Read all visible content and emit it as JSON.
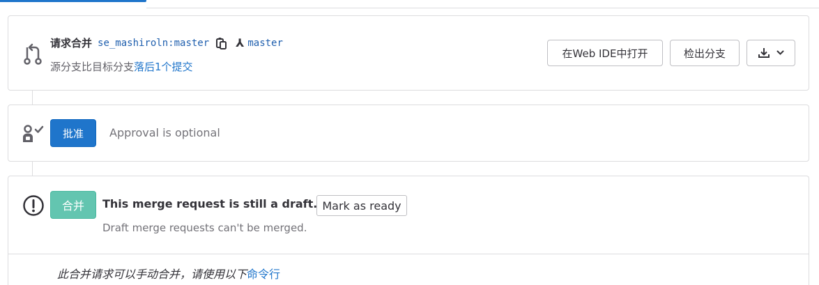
{
  "merge_request": {
    "label": "请求合并",
    "source_branch": "se_mashiroln:master",
    "target_branch": "master",
    "sub_text": "源分支比目标分支",
    "behind_link": "落后1个提交",
    "buttons": {
      "web_ide": "在Web IDE中打开",
      "checkout": "检出分支"
    },
    "icons": [
      "merge-request-icon",
      "copy-icon",
      "into-arrow-icon",
      "download-icon",
      "chevron-down-icon"
    ]
  },
  "approval": {
    "approve_label": "批准",
    "status_text": "Approval is optional",
    "icon": "approval-user-check-icon"
  },
  "merge": {
    "merge_label": "合并",
    "draft_title": "This merge request is still a draft.",
    "mark_ready_label": "Mark as ready",
    "draft_sub": "Draft merge requests can't be merged.",
    "manual_text": "此合并请求可以手动合并，请使用以下",
    "command_link": "命令行",
    "icon": "warning-circle-icon"
  },
  "colors": {
    "accent": "#1f75cb",
    "merge_disabled": "#63c5b0",
    "border": "#dcdcde"
  }
}
